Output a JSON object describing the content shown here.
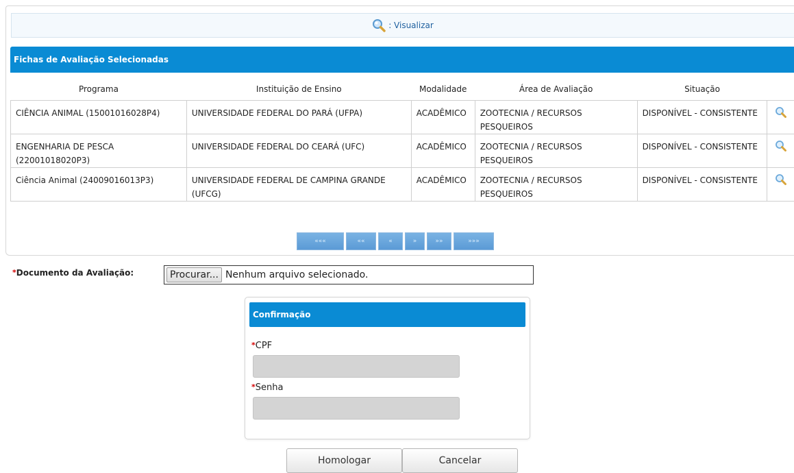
{
  "legend": {
    "icon": "magnifier-icon",
    "label": ": Visualizar"
  },
  "section_title": "Fichas de Avaliação Selecionadas",
  "table": {
    "headers": [
      "Programa",
      "Instituição de Ensino",
      "Modalidade",
      "Área de Avaliação",
      "Situação"
    ],
    "rows": [
      {
        "programa": "CIÊNCIA ANIMAL (15001016028P4)",
        "instituicao": "UNIVERSIDADE FEDERAL DO PARÁ (UFPA)",
        "modalidade": "ACADÊMICO",
        "area": "ZOOTECNIA / RECURSOS PESQUEIROS",
        "situacao": "DISPONÍVEL - CONSISTENTE"
      },
      {
        "programa": "ENGENHARIA DE PESCA (22001018020P3)",
        "instituicao": "UNIVERSIDADE FEDERAL DO CEARÁ (UFC)",
        "modalidade": "ACADÊMICO",
        "area": "ZOOTECNIA / RECURSOS PESQUEIROS",
        "situacao": "DISPONÍVEL - CONSISTENTE"
      },
      {
        "programa": "Ciência Animal (24009016013P3)",
        "instituicao": "UNIVERSIDADE FEDERAL DE CAMPINA GRANDE (UFCG)",
        "modalidade": "ACADÊMICO",
        "area": "ZOOTECNIA / RECURSOS PESQUEIROS",
        "situacao": "DISPONÍVEL - CONSISTENTE"
      }
    ]
  },
  "pager": {
    "first": "«««",
    "prev_page": "««",
    "prev": "«",
    "next": "»",
    "next_page": "»»",
    "last": "»»»"
  },
  "document": {
    "label": "Documento da Avaliação:",
    "button": "Procurar...",
    "status": "Nenhum arquivo selecionado."
  },
  "confirmation": {
    "title": "Confirmação",
    "cpf_label": "CPF",
    "senha_label": "Senha"
  },
  "actions": {
    "homologar": "Homologar",
    "cancelar": "Cancelar"
  },
  "colors": {
    "header_blue": "#0a8bd4",
    "required_red": "#d40000",
    "pager_blue": "#5b9bd6"
  }
}
